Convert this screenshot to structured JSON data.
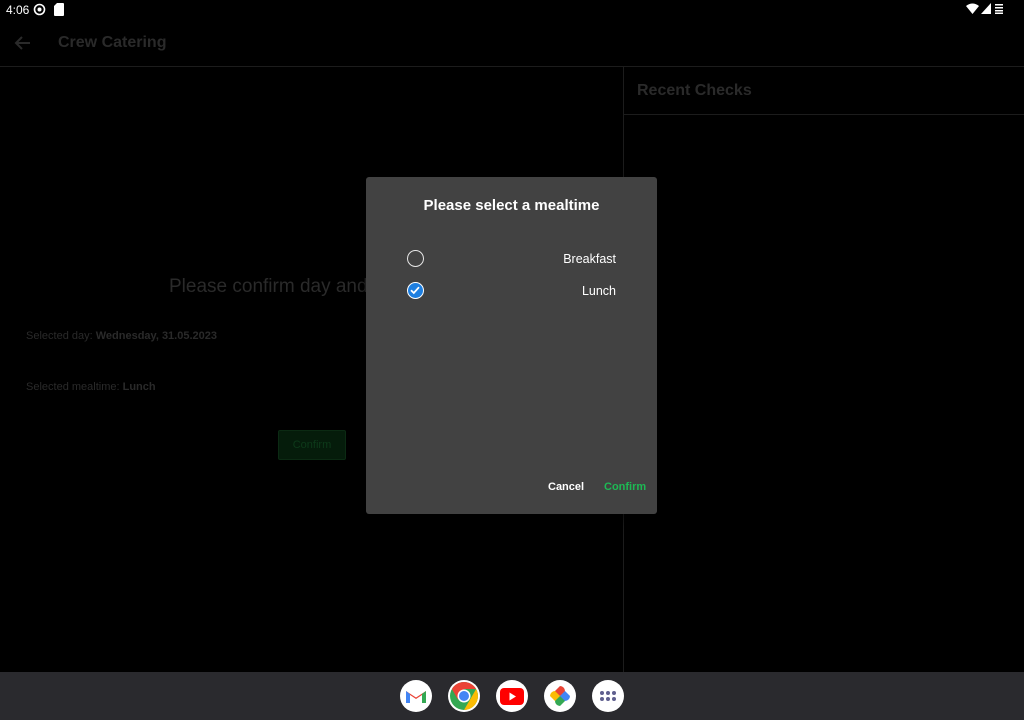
{
  "status": {
    "time": "4:06"
  },
  "appbar": {
    "title": "Crew Catering"
  },
  "recent": {
    "title": "Recent Checks"
  },
  "main": {
    "heading": "Please confirm day and",
    "selected_day_label": "Selected day: ",
    "selected_day_value": "Wednesday, 31.05.2023",
    "selected_meal_label": "Selected mealtime: ",
    "selected_meal_value": "Lunch",
    "confirm_label": "Confirm"
  },
  "dialog": {
    "title": "Please select a mealtime",
    "options": [
      {
        "label": "Breakfast",
        "selected": false
      },
      {
        "label": "Lunch",
        "selected": true
      }
    ],
    "cancel_label": "Cancel",
    "confirm_label": "Confirm"
  },
  "navbar": {
    "apps": [
      "gmail-icon",
      "chrome-icon",
      "youtube-icon",
      "photos-icon",
      "app-drawer-icon"
    ]
  },
  "colors": {
    "accent_green": "#1db954",
    "radio_blue": "#1e7fe0",
    "dialog_bg": "#424242"
  }
}
